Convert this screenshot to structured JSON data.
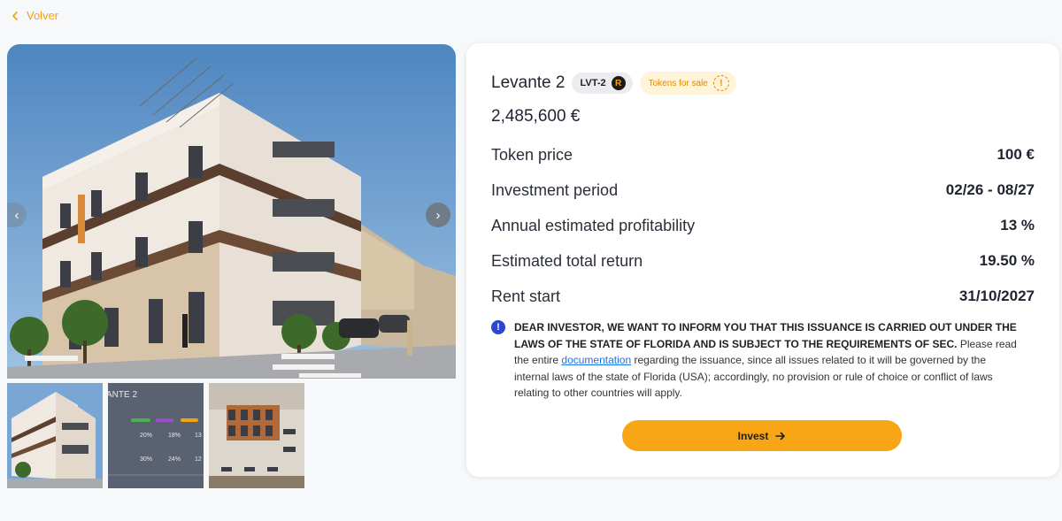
{
  "nav": {
    "back_label": "Volver"
  },
  "property": {
    "title": "Levante 2",
    "ticker": "LVT-2",
    "ticker_logo_letter": "R",
    "status_badge": "Tokens for sale",
    "price": "2,485,600 €"
  },
  "details": [
    {
      "label": "Token price",
      "value": "100 €"
    },
    {
      "label": "Investment period",
      "value": "02/26 - 08/27"
    },
    {
      "label": "Annual estimated profitability",
      "value": "13 %"
    },
    {
      "label": "Estimated total return",
      "value": "19.50 %"
    },
    {
      "label": "Rent start",
      "value": "31/10/2027"
    }
  ],
  "notice": {
    "bold_text": "DEAR INVESTOR, WE WANT TO INFORM YOU THAT THIS ISSUANCE IS CARRIED OUT UNDER THE LAWS OF THE STATE OF FLORIDA AND IS SUBJECT TO THE REQUIREMENTS OF SEC.",
    "text_before_link": "Please read the entire",
    "link_text": "documentation",
    "text_after_link": "regarding the issuance, since all issues related to it will be governed by the internal laws of the state of Florida (USA); accordingly, no provision or rule of choice or conflict of laws relating to other countries will apply."
  },
  "actions": {
    "invest_label": "Invest"
  },
  "thumb2": {
    "title": "ANTE 2",
    "rows": [
      [
        "20%",
        "18%",
        "13"
      ],
      [
        "30%",
        "24%",
        "12"
      ]
    ]
  },
  "colors": {
    "accent": "#f8a516",
    "info": "#2b45d6",
    "link": "#1a73e8"
  }
}
